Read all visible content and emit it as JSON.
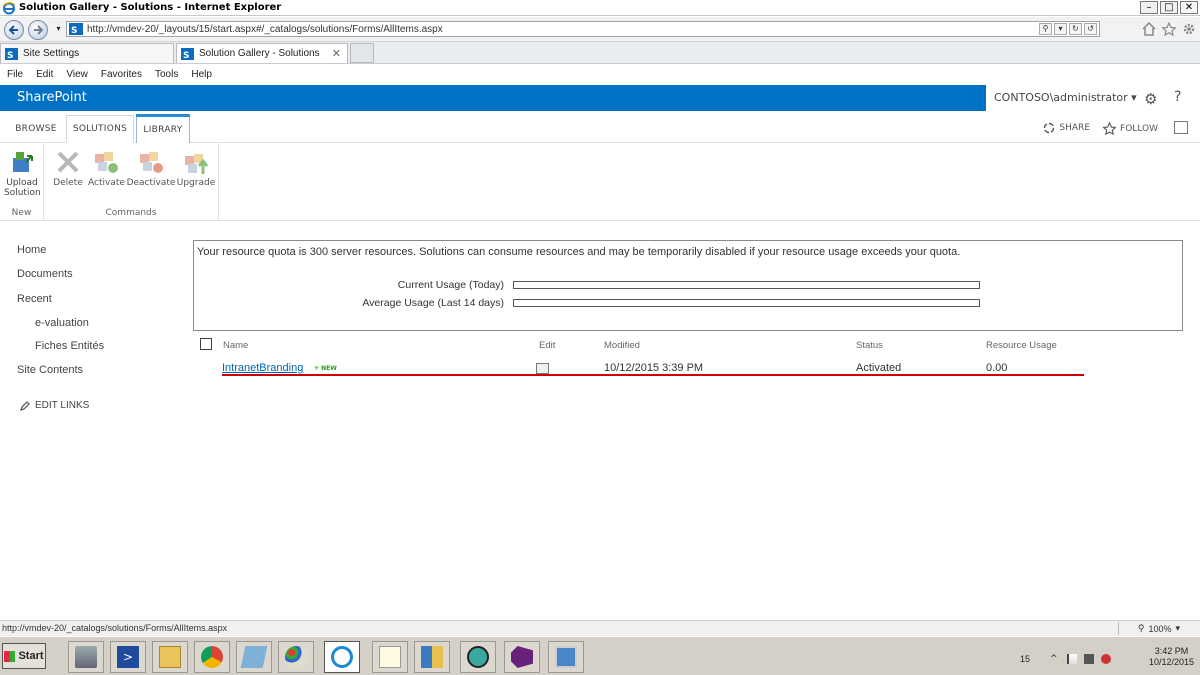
{
  "window": {
    "title": "Solution Gallery - Solutions - Internet Explorer"
  },
  "address": {
    "url": "http://vmdev-20/_layouts/15/start.aspx#/_catalogs/solutions/Forms/AllItems.aspx"
  },
  "tabs": [
    {
      "label": "Site Settings"
    },
    {
      "label": "Solution Gallery - Solutions"
    }
  ],
  "menu": [
    "File",
    "Edit",
    "View",
    "Favorites",
    "Tools",
    "Help"
  ],
  "suite": {
    "brand": "SharePoint",
    "user": "CONTOSO\\administrator ▾",
    "brand_color": "#0072c6"
  },
  "ribbon_tabs": {
    "browse": "BROWSE",
    "solutions": "SOLUTIONS",
    "library": "LIBRARY"
  },
  "page_actions": {
    "share": "SHARE",
    "follow": "FOLLOW"
  },
  "ribbon": {
    "new_group": "New",
    "commands_group": "Commands",
    "upload_line1": "Upload",
    "upload_line2": "Solution",
    "delete": "Delete",
    "activate": "Activate",
    "deactivate": "Deactivate",
    "upgrade": "Upgrade"
  },
  "leftnav": {
    "home": "Home",
    "documents": "Documents",
    "recent": "Recent",
    "evaluation": "e-valuation",
    "fiches": "Fiches Entités",
    "site_contents": "Site Contents",
    "edit_links": "EDIT LINKS"
  },
  "quota": {
    "message": "Your resource quota is 300 server resources. Solutions can consume resources and may be temporarily disabled if your resource usage exceeds your quota.",
    "current_label": "Current Usage (Today)",
    "average_label": "Average Usage (Last 14 days)",
    "current_fraction": 0,
    "average_fraction": 0
  },
  "list": {
    "headers": {
      "name": "Name",
      "edit": "Edit",
      "modified": "Modified",
      "status": "Status",
      "resource": "Resource Usage"
    },
    "rows": [
      {
        "name": "IntranetBranding",
        "badge": "NEW",
        "modified": "10/12/2015 3:39 PM",
        "status": "Activated",
        "resource": "0.00"
      }
    ]
  },
  "statusbar": {
    "url": "http://vmdev-20/_catalogs/solutions/Forms/AllItems.aspx",
    "zoom": "100%"
  },
  "taskbar": {
    "start": "Start",
    "tray_number": "15",
    "time": "3:42 PM",
    "date": "10/12/2015"
  }
}
